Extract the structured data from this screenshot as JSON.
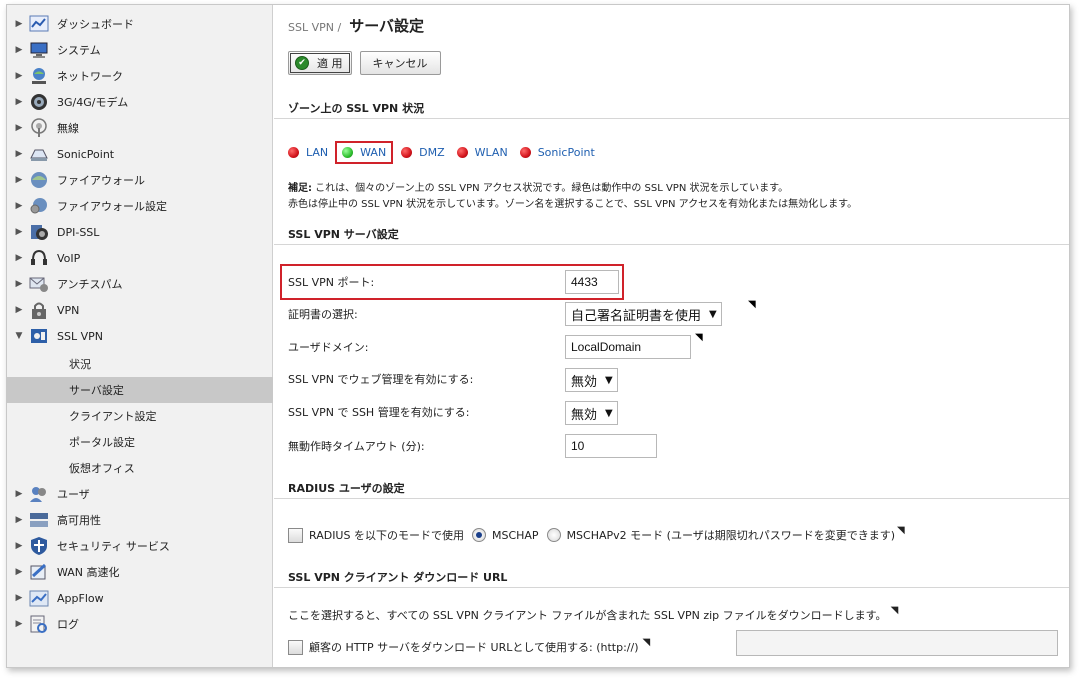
{
  "sidebar": {
    "items": [
      {
        "label": "ダッシュボード",
        "icon": "dashboard-icon"
      },
      {
        "label": "システム",
        "icon": "system-icon"
      },
      {
        "label": "ネットワーク",
        "icon": "network-icon"
      },
      {
        "label": "3G/4G/モデム",
        "icon": "modem-icon"
      },
      {
        "label": "無線",
        "icon": "wireless-icon"
      },
      {
        "label": "SonicPoint",
        "icon": "sonicpoint-icon"
      },
      {
        "label": "ファイアウォール",
        "icon": "firewall-icon"
      },
      {
        "label": "ファイアウォール設定",
        "icon": "firewall-settings-icon"
      },
      {
        "label": "DPI-SSL",
        "icon": "dpi-ssl-icon"
      },
      {
        "label": "VoIP",
        "icon": "voip-icon"
      },
      {
        "label": "アンチスパム",
        "icon": "antispam-icon"
      },
      {
        "label": "VPN",
        "icon": "vpn-icon"
      },
      {
        "label": "SSL VPN",
        "icon": "ssl-vpn-icon"
      },
      {
        "label": "ユーザ",
        "icon": "users-icon"
      },
      {
        "label": "高可用性",
        "icon": "high-availability-icon"
      },
      {
        "label": "セキュリティ サービス",
        "icon": "security-services-icon"
      },
      {
        "label": "WAN 高速化",
        "icon": "wan-acceleration-icon"
      },
      {
        "label": "AppFlow",
        "icon": "appflow-icon"
      },
      {
        "label": "ログ",
        "icon": "log-icon"
      }
    ],
    "ssl_vpn_sub": [
      {
        "label": "状況"
      },
      {
        "label": "サーバ設定"
      },
      {
        "label": "クライアント設定"
      },
      {
        "label": "ポータル設定"
      },
      {
        "label": "仮想オフィス"
      }
    ]
  },
  "breadcrumb": {
    "parent": "SSL VPN /",
    "current": "サーバ設定"
  },
  "toolbar": {
    "apply_label": "適 用",
    "cancel_label": "キャンセル"
  },
  "zones_section": {
    "title": "ゾーン上の SSL VPN 状況",
    "zones": [
      {
        "label": "LAN",
        "color": "#d2141c"
      },
      {
        "label": "WAN",
        "color": "#2fbf2f"
      },
      {
        "label": "DMZ",
        "color": "#d2141c"
      },
      {
        "label": "WLAN",
        "color": "#d2141c"
      },
      {
        "label": "SonicPoint",
        "color": "#d2141c"
      }
    ],
    "note_bold": "補足:",
    "note_line1": " これは、個々のゾーン上の SSL VPN アクセス状況です。緑色は動作中の SSL VPN 状況を示しています。",
    "note_line2": "赤色は停止中の SSL VPN 状況を示しています。ゾーン名を選択することで、SSL VPN アクセスを有効化または無効化します。"
  },
  "server_section": {
    "title": "SSL VPN サーバ設定",
    "port_label": "SSL VPN ポート:",
    "port_value": "4433",
    "cert_label": "証明書の選択:",
    "cert_value": "自己署名証明書を使用",
    "domain_label": "ユーザドメイン:",
    "domain_value": "LocalDomain",
    "web_mgmt_label": "SSL VPN でウェブ管理を有効にする:",
    "web_mgmt_value": "無効",
    "ssh_mgmt_label": "SSL VPN で SSH 管理を有効にする:",
    "ssh_mgmt_value": "無効",
    "timeout_label": "無動作時タイムアウト (分):",
    "timeout_value": "10"
  },
  "radius_section": {
    "title": "RADIUS ユーザの設定",
    "use_label": "RADIUS を以下のモードで使用",
    "opt1": "MSCHAP",
    "opt2": "MSCHAPv2 モード (ユーザは期限切れパスワードを変更できます)"
  },
  "download_section": {
    "title": "SSL VPN クライアント ダウンロード URL",
    "link_text": "ここを選択",
    "desc_text": "すると、すべての SSL VPN クライアント ファイルが含まれた SSL VPN zip ファイルをダウンロードします。",
    "custom_label": "顧客の HTTP サーバをダウンロード URLとして使用する: (http://)"
  }
}
